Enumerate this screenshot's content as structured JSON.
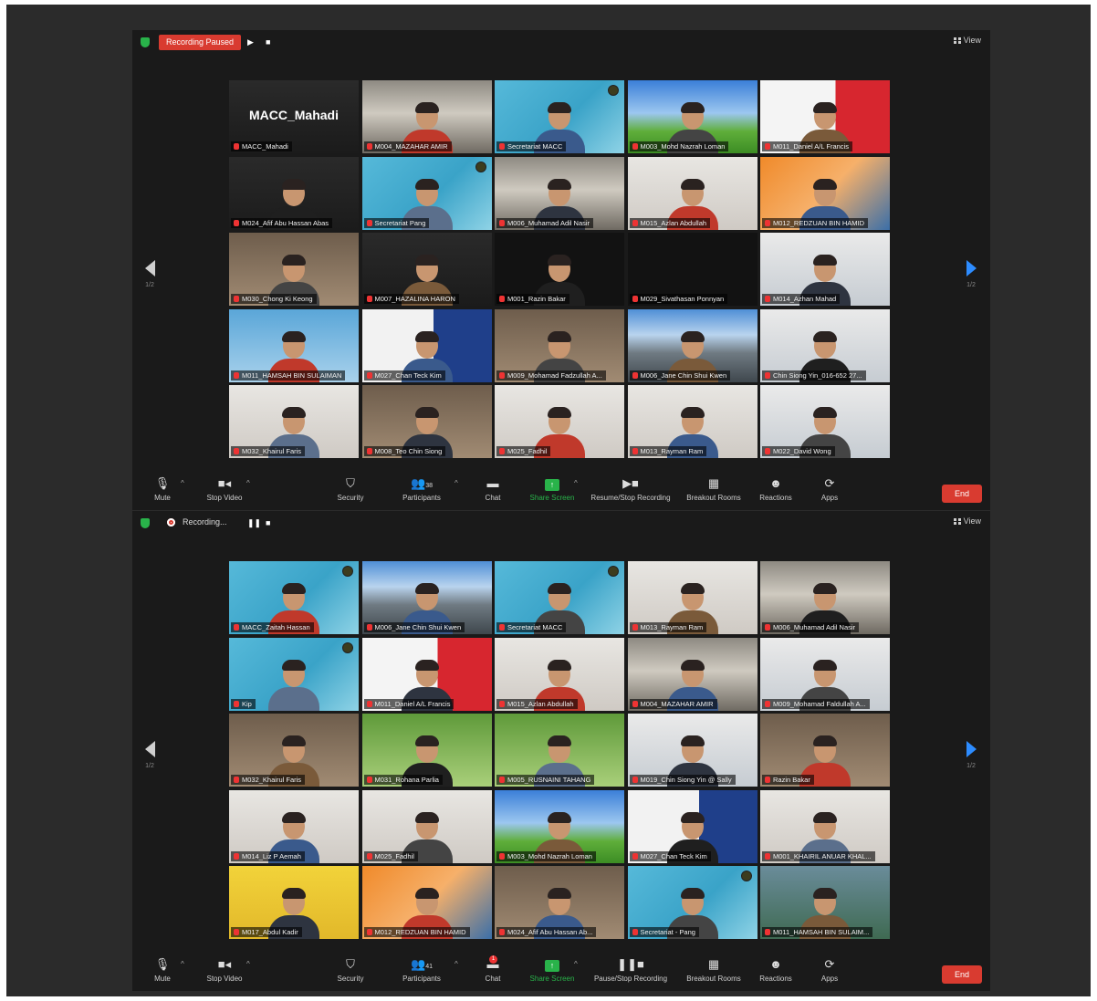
{
  "windows": [
    {
      "recording_label": "Recording Paused",
      "recording_style": "paused",
      "view_label": "View",
      "page_indicator": "1/2",
      "participants_count": "38",
      "resume_label": "Resume/Stop Recording",
      "chat_badge": "",
      "tiles": [
        {
          "name": "MACC_Mahadi",
          "host": true,
          "active": true,
          "scene": "dark",
          "big": "MACC_Mahadi"
        },
        {
          "name": "M004_MAZAHAR AMIR",
          "scene": "office"
        },
        {
          "name": "Secretariat MACC",
          "scene": "teal",
          "badge": true
        },
        {
          "name": "M003_Mohd Nazrah Loman",
          "scene": "sky"
        },
        {
          "name": "M011_Daniel A/L Francis",
          "scene": "bsi"
        },
        {
          "name": "M024_Afif Abu Hassan Abas",
          "scene": "dark"
        },
        {
          "name": "Secretariat Pang",
          "scene": "teal",
          "badge": true
        },
        {
          "name": "M006_Muhamad Adil Nasir",
          "scene": "office"
        },
        {
          "name": "M015_Azlan Abdullah",
          "scene": "white"
        },
        {
          "name": "M012_REDZUAN BIN HAMID",
          "scene": "orange"
        },
        {
          "name": "M030_Chong Ki Keong",
          "scene": "room"
        },
        {
          "name": "M007_HAZALINA HARON",
          "scene": "dark"
        },
        {
          "name": "M001_Razin Bakar",
          "scene": "black"
        },
        {
          "name": "M029_Sivathasan Ponnyan",
          "scene": "black",
          "empty": true
        },
        {
          "name": "M014_Azhan Mahad",
          "scene": "bright"
        },
        {
          "name": "M011_HAMSAH BIN SULAIMAN",
          "scene": "blue"
        },
        {
          "name": "M027_Chan Teck Kim",
          "scene": "navy"
        },
        {
          "name": "M009_Mohamad Fadzullah A...",
          "scene": "room"
        },
        {
          "name": "M006_Jane Chin Shui Kwen",
          "scene": "mountain"
        },
        {
          "name": "Chin Siong Yin_016-652 27...",
          "scene": "bright"
        },
        {
          "name": "M032_Khairul Faris",
          "scene": "white"
        },
        {
          "name": "M008_Teo Chin Siong",
          "scene": "room"
        },
        {
          "name": "M025_Fadhil",
          "scene": "white"
        },
        {
          "name": "M013_Rayman Ram",
          "scene": "white"
        },
        {
          "name": "M022_David Wong",
          "scene": "bright"
        }
      ]
    },
    {
      "recording_label": "Recording...",
      "recording_style": "active",
      "view_label": "View",
      "page_indicator": "1/2",
      "participants_count": "41",
      "resume_label": "Pause/Stop Recording",
      "chat_badge": "1",
      "tiles": [
        {
          "name": "MACC_Zaitah Hassan",
          "scene": "teal",
          "active": true,
          "badge": true
        },
        {
          "name": "M006_Jane Chin Shui Kwen",
          "scene": "mountain"
        },
        {
          "name": "Secretariat MACC",
          "scene": "teal",
          "badge": true
        },
        {
          "name": "M013_Rayman Ram",
          "scene": "white"
        },
        {
          "name": "M006_Muhamad Adil Nasir",
          "scene": "office"
        },
        {
          "name": "Kip",
          "scene": "teal",
          "badge": true
        },
        {
          "name": "M011_Daniel A/L Francis",
          "scene": "bsi"
        },
        {
          "name": "M015_Azlan Abdullah",
          "scene": "white"
        },
        {
          "name": "M004_MAZAHAR AMIR",
          "scene": "office"
        },
        {
          "name": "M009_Mohamad Faldullah A...",
          "scene": "bright"
        },
        {
          "name": "M032_Khairul Faris",
          "scene": "room"
        },
        {
          "name": "M031_Rohana Parlia",
          "scene": "green"
        },
        {
          "name": "M005_RUSNAINI TAHANG",
          "scene": "green"
        },
        {
          "name": "M019_Chin Siong Yin @ Sally",
          "scene": "bright"
        },
        {
          "name": "Razin Bakar",
          "scene": "room"
        },
        {
          "name": "M014_Liz P Aemah",
          "scene": "white"
        },
        {
          "name": "M025_Fadhil",
          "scene": "white"
        },
        {
          "name": "M003_Mohd Nazrah Loman",
          "scene": "sky"
        },
        {
          "name": "M027_Chan Teck Kim",
          "scene": "navy"
        },
        {
          "name": "M001_KHAIRIL ANUAR KHAL...",
          "scene": "white"
        },
        {
          "name": "M017_Abdul Kadir",
          "scene": "yellow"
        },
        {
          "name": "M012_REDZUAN BIN HAMID",
          "scene": "orange"
        },
        {
          "name": "M024_Afif Abu Hassan Ab...",
          "scene": "room"
        },
        {
          "name": "Secretariat - Pang",
          "scene": "teal",
          "badge": true
        },
        {
          "name": "M011_HAMSAH BIN SULAIM...",
          "scene": "lake"
        }
      ]
    }
  ],
  "toolbar": {
    "mute": "Mute",
    "stop_video": "Stop Video",
    "security": "Security",
    "participants": "Participants",
    "chat": "Chat",
    "share_screen": "Share Screen",
    "breakout_rooms": "Breakout Rooms",
    "reactions": "Reactions",
    "apps": "Apps",
    "end": "End"
  },
  "icons": {
    "mute": "microphone-icon",
    "video": "video-camera-icon",
    "security": "shield-icon",
    "participants": "people-icon",
    "chat": "chat-bubble-icon",
    "share": "share-screen-icon",
    "recording": "record-icon",
    "breakout": "grid-icon",
    "reactions": "smiley-icon",
    "apps": "apps-icon"
  },
  "colors": {
    "accent_green": "#29b34a",
    "end_red": "#d93b30",
    "active_speaker": "#c9e244",
    "nav_blue": "#2d8cff"
  }
}
